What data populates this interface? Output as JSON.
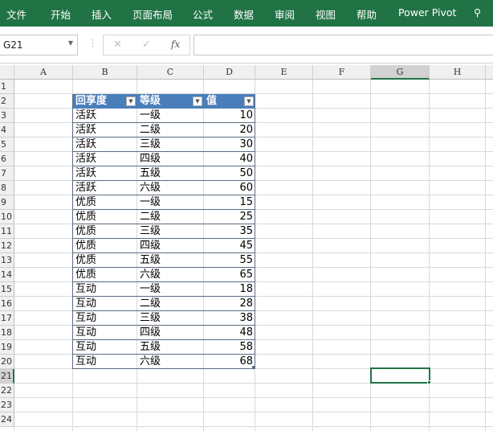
{
  "ribbon": {
    "tabs": [
      "文件",
      "开始",
      "插入",
      "页面布局",
      "公式",
      "数据",
      "审阅",
      "视图",
      "帮助",
      "Power Pivot"
    ]
  },
  "formula_bar": {
    "name_box": "G21",
    "cancel": "✕",
    "enter": "✓",
    "fx": "fx",
    "value": ""
  },
  "columns": [
    "A",
    "B",
    "C",
    "D",
    "E",
    "F",
    "G",
    "H"
  ],
  "rows": [
    "1",
    "2",
    "3",
    "4",
    "5",
    "6",
    "7",
    "8",
    "9",
    "10",
    "11",
    "12",
    "13",
    "14",
    "15",
    "16",
    "17",
    "18",
    "19",
    "20",
    "21",
    "22",
    "23",
    "24"
  ],
  "table": {
    "headers": [
      "回享度",
      "等级",
      "值"
    ],
    "rows": [
      [
        "活跃",
        "一级",
        "10"
      ],
      [
        "活跃",
        "二级",
        "20"
      ],
      [
        "活跃",
        "三级",
        "30"
      ],
      [
        "活跃",
        "四级",
        "40"
      ],
      [
        "活跃",
        "五级",
        "50"
      ],
      [
        "活跃",
        "六级",
        "60"
      ],
      [
        "优质",
        "一级",
        "15"
      ],
      [
        "优质",
        "二级",
        "25"
      ],
      [
        "优质",
        "三级",
        "35"
      ],
      [
        "优质",
        "四级",
        "45"
      ],
      [
        "优质",
        "五级",
        "55"
      ],
      [
        "优质",
        "六级",
        "65"
      ],
      [
        "互动",
        "一级",
        "18"
      ],
      [
        "互动",
        "二级",
        "28"
      ],
      [
        "互动",
        "三级",
        "38"
      ],
      [
        "互动",
        "四级",
        "48"
      ],
      [
        "互动",
        "五级",
        "58"
      ],
      [
        "互动",
        "六级",
        "68"
      ]
    ]
  },
  "selected_cell": "G21",
  "colors": {
    "ribbon": "#217346",
    "table_header": "#4a7ebb"
  }
}
